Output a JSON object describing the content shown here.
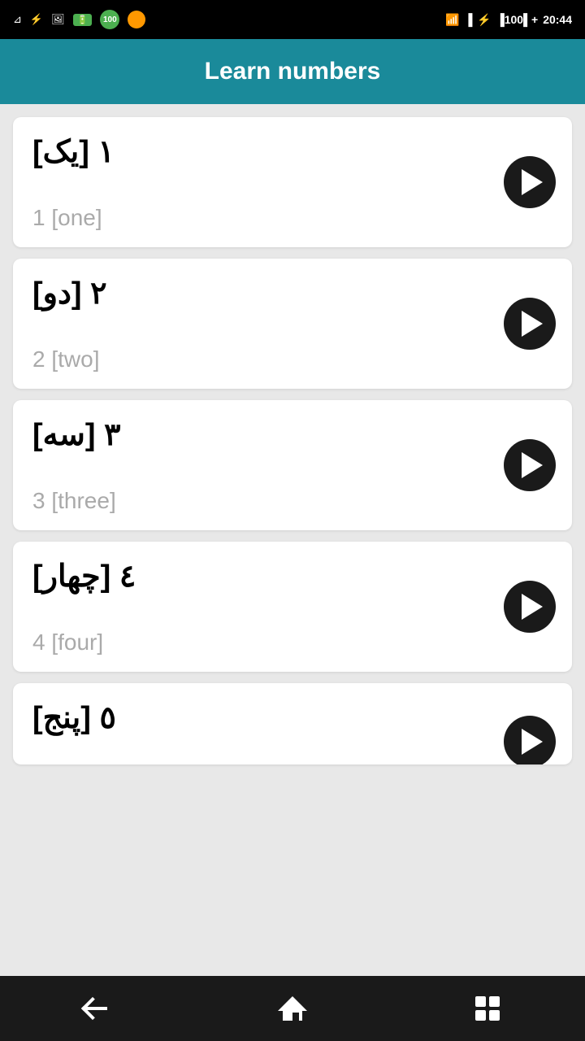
{
  "statusBar": {
    "time": "20:44",
    "batteryLevel": "100"
  },
  "header": {
    "title": "Learn numbers"
  },
  "numbers": [
    {
      "id": 1,
      "arabic": "١ [یک]",
      "english": "1 [one]"
    },
    {
      "id": 2,
      "arabic": "٢ [دو]",
      "english": "2 [two]"
    },
    {
      "id": 3,
      "arabic": "٣ [سه]",
      "english": "3 [three]"
    },
    {
      "id": 4,
      "arabic": "٤ [چهار]",
      "english": "4 [four]"
    },
    {
      "id": 5,
      "arabic": "٥ [پنج]",
      "english": ""
    }
  ],
  "nav": {
    "back_label": "back",
    "home_label": "home",
    "recents_label": "recents"
  }
}
